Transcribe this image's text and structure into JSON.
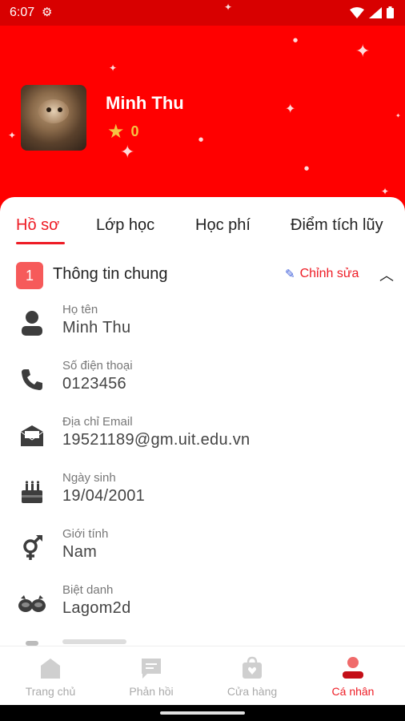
{
  "status_bar": {
    "time": "6:07"
  },
  "profile": {
    "name": "Minh Thu",
    "points": "0"
  },
  "tabs": [
    {
      "label": "Hồ sơ",
      "active": true
    },
    {
      "label": "Lớp học",
      "active": false
    },
    {
      "label": "Học phí",
      "active": false
    },
    {
      "label": "Điểm tích lũy",
      "active": false
    }
  ],
  "section": {
    "number": "1",
    "title": "Thông tin chung",
    "edit_label": "Chỉnh sửa"
  },
  "fields": [
    {
      "label": "Họ tên",
      "value": "Minh Thu",
      "icon": "person-icon"
    },
    {
      "label": "Số điện thoại",
      "value": "0123456",
      "icon": "phone-icon"
    },
    {
      "label": "Địa chỉ Email",
      "value": "19521189@gm.uit.edu.vn",
      "icon": "email-icon"
    },
    {
      "label": "Ngày sinh",
      "value": "19/04/2001",
      "icon": "birthday-cake-icon"
    },
    {
      "label": "Giới tính",
      "value": "Nam",
      "icon": "gender-icon"
    },
    {
      "label": "Biệt danh",
      "value": "Lagom2d",
      "icon": "nickname-icon"
    }
  ],
  "bottom_nav": [
    {
      "label": "Trang chủ",
      "icon": "home-icon",
      "active": false
    },
    {
      "label": "Phản hồi",
      "icon": "feedback-icon",
      "active": false
    },
    {
      "label": "Cửa hàng",
      "icon": "store-icon",
      "active": false
    },
    {
      "label": "Cá nhân",
      "icon": "profile-icon",
      "active": true
    }
  ],
  "colors": {
    "header_red": "#ff0000",
    "accent_red": "#ee1c25",
    "star_gold": "#f5c343"
  }
}
